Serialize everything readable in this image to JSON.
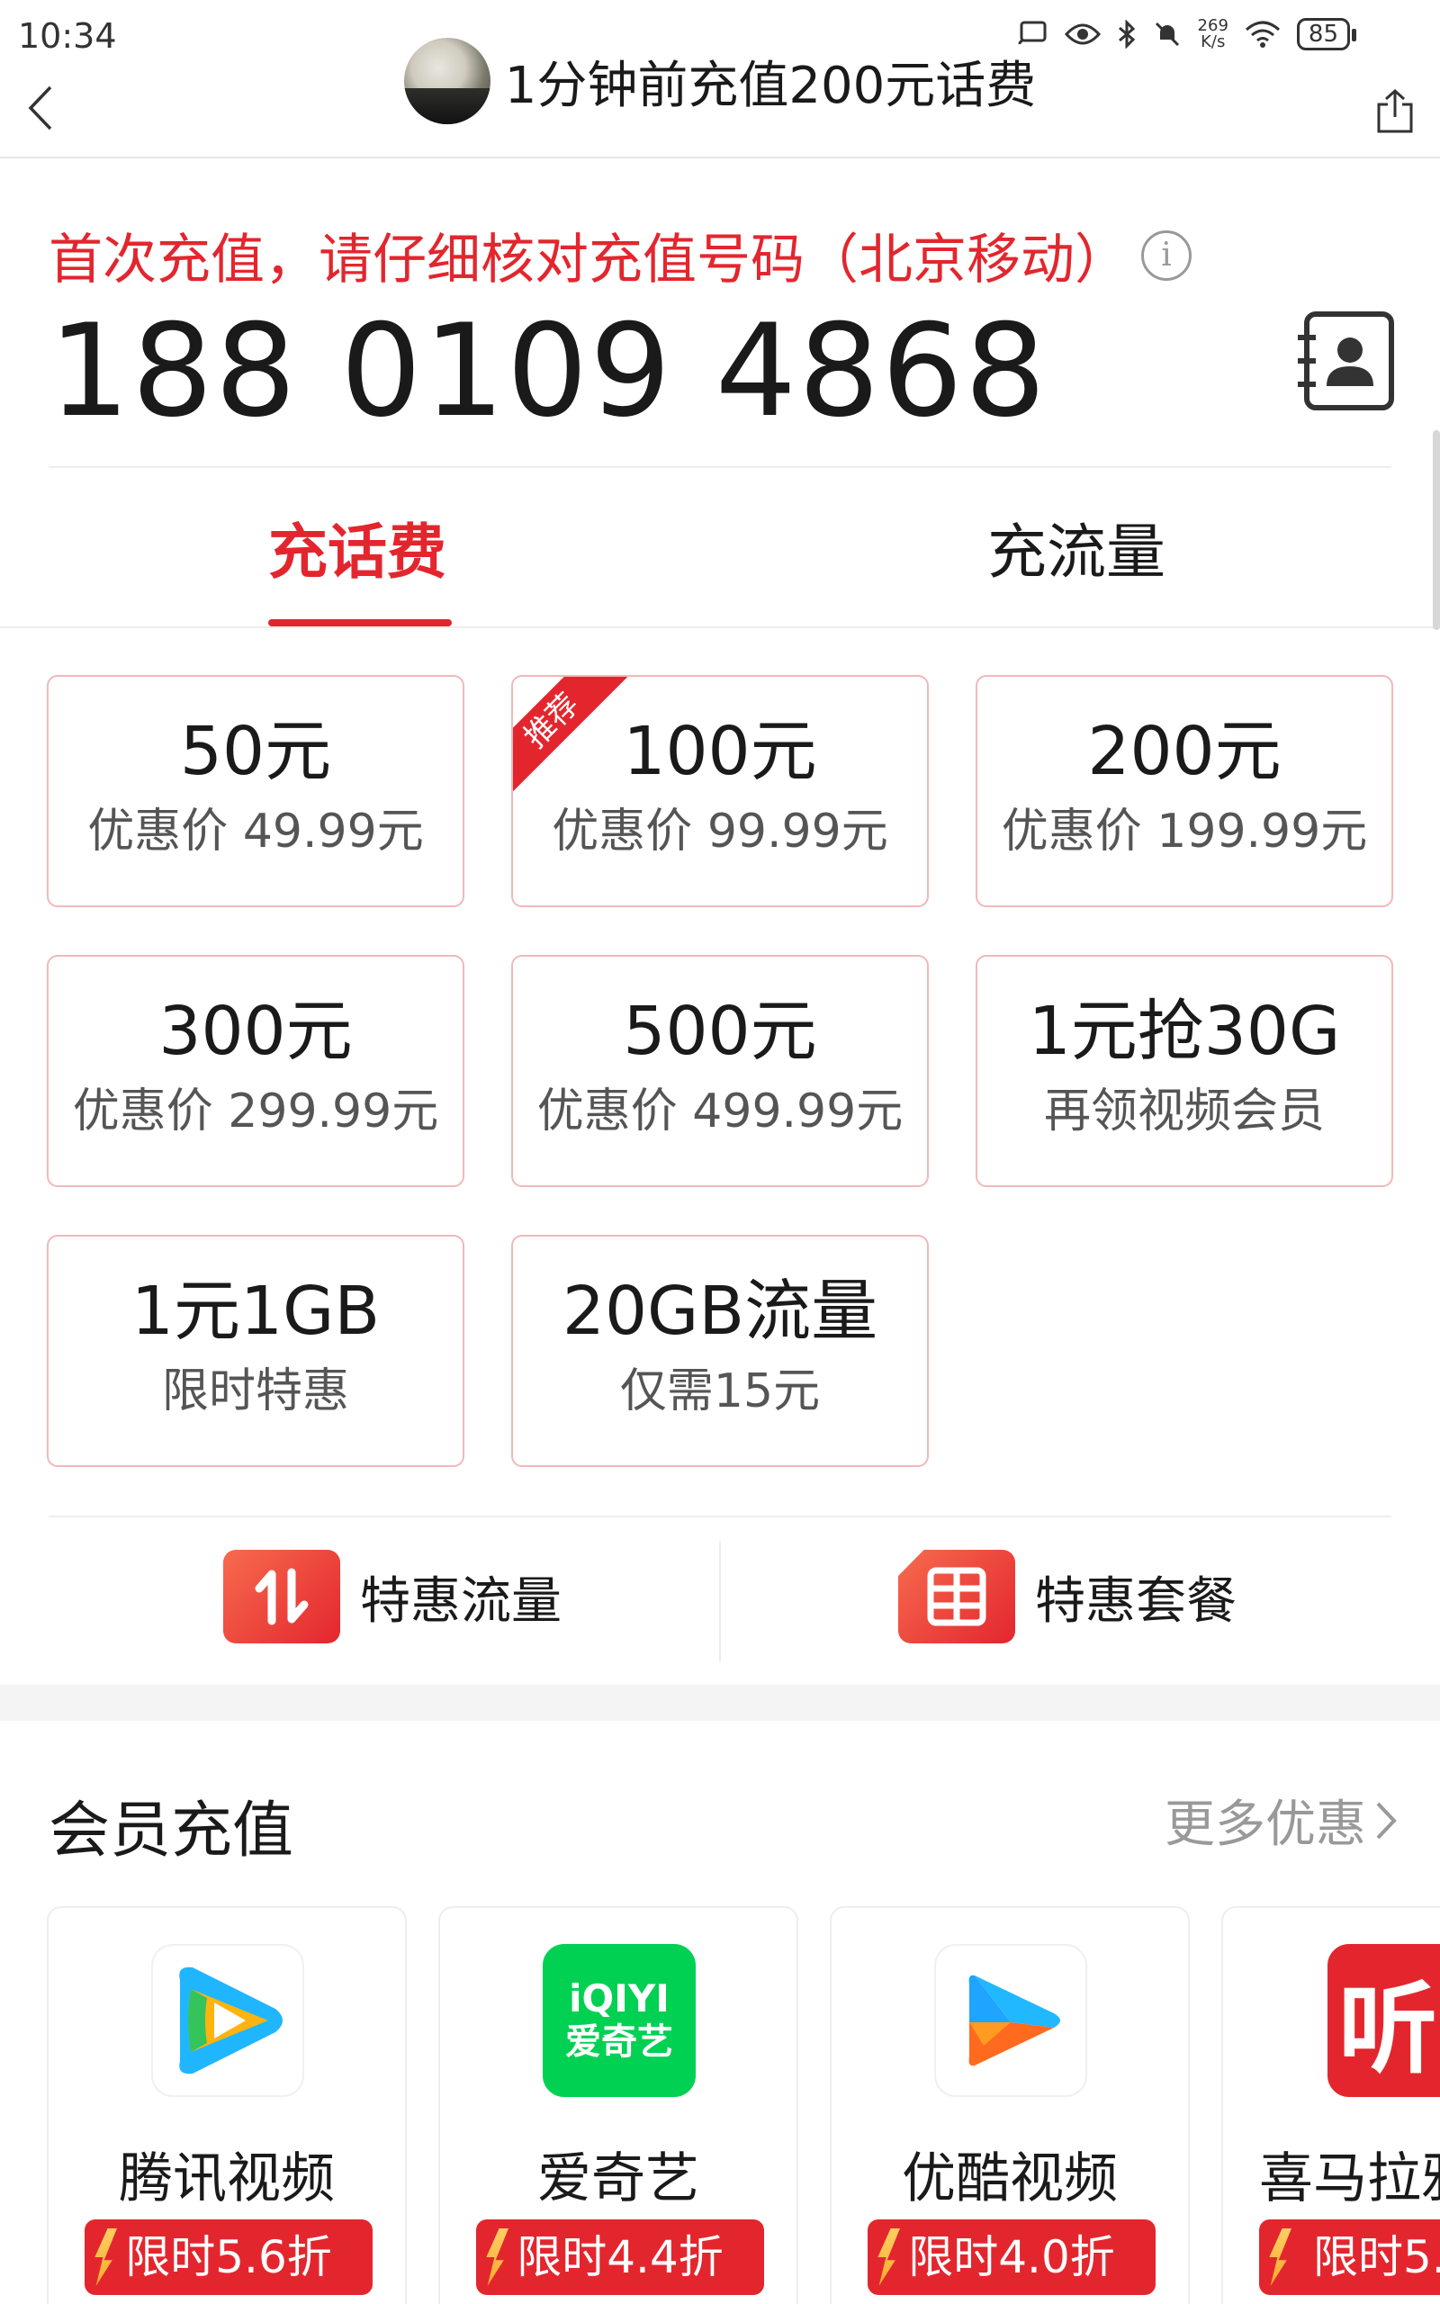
{
  "status_bar": {
    "time": "10:34",
    "speed_value": "269",
    "speed_unit": "K/s",
    "battery": "85"
  },
  "header": {
    "title": "1分钟前充值200元话费",
    "icons": [
      "back-icon",
      "share-icon"
    ]
  },
  "recharge": {
    "warning": "首次充值，请仔细核对充值号码（北京移动）",
    "info_glyph": "i",
    "phone_number": "188 0109 4868"
  },
  "tabs": [
    {
      "label": "充话费",
      "active": true
    },
    {
      "label": "充流量",
      "active": false
    }
  ],
  "products": [
    {
      "main": "50元",
      "sub": "优惠价 49.99元"
    },
    {
      "main": "100元",
      "sub": "优惠价 99.99元",
      "badge": "推荐"
    },
    {
      "main": "200元",
      "sub": "优惠价 199.99元"
    },
    {
      "main": "300元",
      "sub": "优惠价 299.99元"
    },
    {
      "main": "500元",
      "sub": "优惠价 499.99元"
    },
    {
      "main": "1元抢30G",
      "sub": "再领视频会员"
    },
    {
      "main": "1元1GB",
      "sub": "限时特惠"
    },
    {
      "main": "20GB流量",
      "sub": "仅需15元"
    }
  ],
  "quick_links": [
    {
      "label": "特惠流量",
      "icon": "arrows-up-down-icon"
    },
    {
      "label": "特惠套餐",
      "icon": "sim-card-icon"
    }
  ],
  "membership": {
    "title": "会员充值",
    "more": "更多优惠",
    "items": [
      {
        "name": "腾讯视频",
        "tag": "限时5.6折"
      },
      {
        "name": "爱奇艺",
        "tag": "限时4.4折",
        "logo_text_top": "iQIYI",
        "logo_text_bottom": "爱奇艺"
      },
      {
        "name": "优酷视频",
        "tag": "限时4.0折"
      },
      {
        "name": "喜马拉雅",
        "tag": "限时5.",
        "logo_text": "听"
      }
    ]
  },
  "colors": {
    "accent": "#e3262e",
    "card_border": "#f2b8b8"
  }
}
